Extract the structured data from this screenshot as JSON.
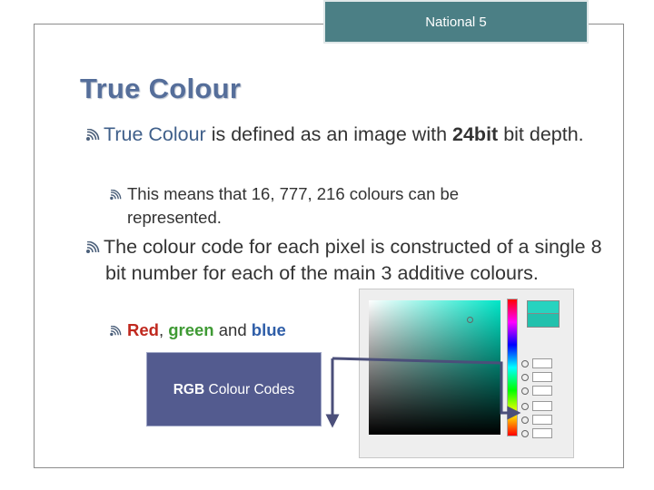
{
  "header": {
    "course_label": "National 5"
  },
  "slide": {
    "title": "True Colour"
  },
  "bullets": {
    "b1_term": "True Colour",
    "b1_mid": " is defined as an image with ",
    "b1_bold": "24bit",
    "b1_end": "bit depth.",
    "b1_sub": "This means that 16, 777, 216 colours can be represented.",
    "b2_text": "The colour code for each pixel is constructed of a single 8 bit number for each of the main 3 additive colours.",
    "b2_sub_red": "Red",
    "b2_sub_comma": ",",
    "b2_sub_green": "green",
    "b2_sub_and": " and ",
    "b2_sub_blue": "blue"
  },
  "rgb_box": {
    "bold": "RGB",
    "rest": " Colour Codes"
  },
  "colors": {
    "title": "#556e9a",
    "header_tab": "#4b7f85",
    "rgb_box": "#535b8f",
    "red": "#c0291f",
    "green": "#3f9a34",
    "blue": "#2f5ea8",
    "arrow": "#4b4f7a"
  },
  "icons": {
    "bullet": "wifi-arc-bullet-icon"
  }
}
